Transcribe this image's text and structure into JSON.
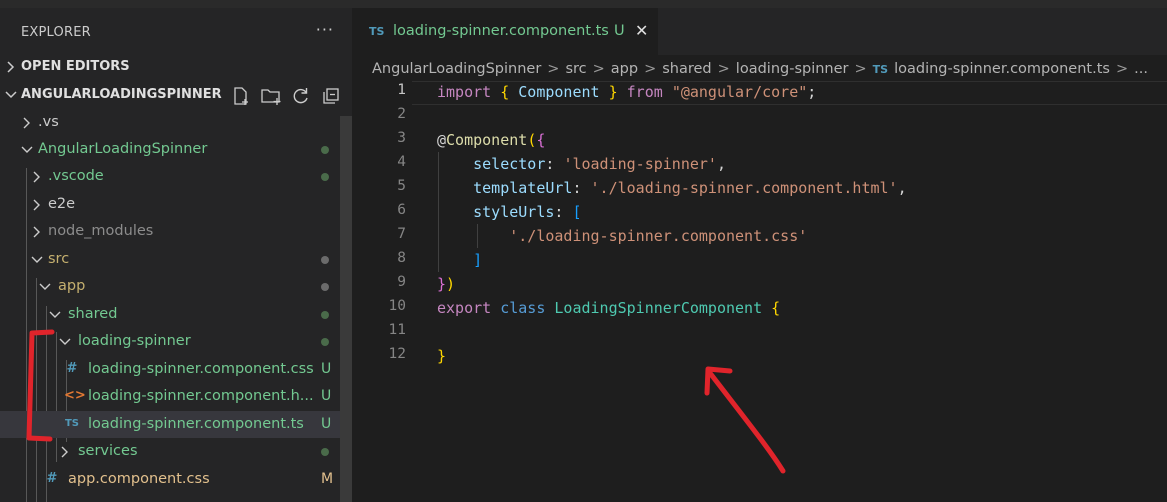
{
  "explorer": {
    "title": "EXPLORER",
    "more": "···",
    "sections": {
      "open_editors": "OPEN EDITORS",
      "project": "ANGULARLOADINGSPINNER"
    },
    "tree": [
      {
        "name": ".vs",
        "color": "#cccccc"
      },
      {
        "name": "AngularLoadingSpinner",
        "color": "#73c991"
      },
      {
        "name": ".vscode",
        "color": "#73c991"
      },
      {
        "name": "e2e",
        "color": "#cccccc"
      },
      {
        "name": "node_modules",
        "color": "#8c8c8c"
      },
      {
        "name": "src",
        "color": "#c5b06f"
      },
      {
        "name": "app",
        "color": "#c5b06f"
      },
      {
        "name": "shared",
        "color": "#73c991"
      },
      {
        "name": "loading-spinner",
        "color": "#73c991"
      },
      {
        "name": "loading-spinner.component.css",
        "badge": "U",
        "color": "#73c991"
      },
      {
        "name": "loading-spinner.component.h...",
        "badge": "U",
        "color": "#73c991"
      },
      {
        "name": "loading-spinner.component.ts",
        "badge": "U",
        "color": "#73c991"
      },
      {
        "name": "services",
        "color": "#73c991"
      },
      {
        "name": "app.component.css",
        "badge": "M",
        "color": "#e2c08d"
      }
    ]
  },
  "editor": {
    "tab": {
      "icon": "TS",
      "name": "loading-spinner.component.ts",
      "badge": "U",
      "close": "✕"
    },
    "breadcrumb": [
      "AngularLoadingSpinner",
      "src",
      "app",
      "shared",
      "loading-spinner",
      "loading-spinner.component.ts",
      "..."
    ],
    "breadcrumb_sep": ">",
    "line_numbers": [
      "1",
      "2",
      "3",
      "4",
      "5",
      "6",
      "7",
      "8",
      "9",
      "10",
      "11",
      "12"
    ]
  },
  "colors": {
    "accent_annotation": "#e0242b",
    "untracked": "#73c991",
    "modified": "#e2c08d"
  }
}
